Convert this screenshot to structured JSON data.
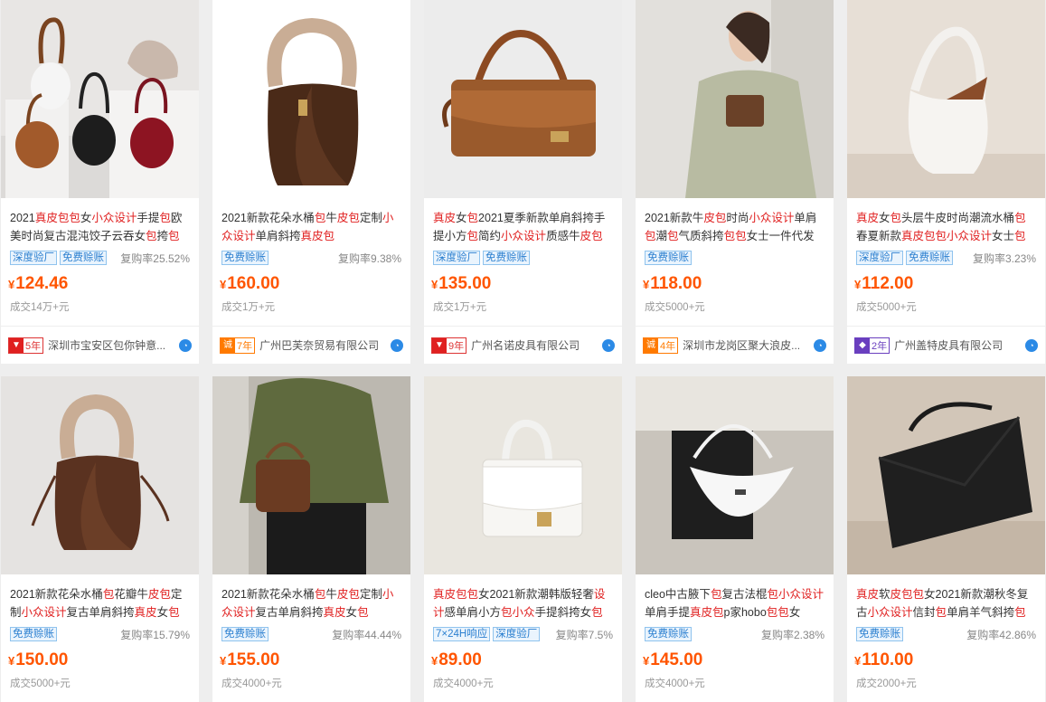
{
  "products": [
    {
      "title_parts": [
        [
          "2021",
          0
        ],
        [
          "真皮包包",
          1
        ],
        [
          "女",
          0
        ],
        [
          "小众设计",
          1
        ],
        [
          "手提",
          0
        ],
        [
          "包",
          1
        ],
        [
          "欧美时尚复古混沌饺子云吞女",
          0
        ],
        [
          "包",
          1
        ],
        [
          "挎",
          0
        ],
        [
          "包",
          1
        ]
      ],
      "tags": [
        "深度验厂",
        "免费赊账"
      ],
      "rate": "复购率25.52%",
      "price": "124.46",
      "deal": "成交14万+元",
      "years": "5年",
      "year_style": "red",
      "shop": "深圳市宝安区包你钟意..."
    },
    {
      "title_parts": [
        [
          "2021新款花朵水桶",
          0
        ],
        [
          "包",
          1
        ],
        [
          "牛",
          0
        ],
        [
          "皮包",
          1
        ],
        [
          "定制",
          0
        ],
        [
          "小众设计",
          1
        ],
        [
          "单肩斜挎",
          0
        ],
        [
          "真皮包",
          1
        ]
      ],
      "tags": [
        "免费赊账"
      ],
      "rate": "复购率9.38%",
      "price": "160.00",
      "deal": "成交1万+元",
      "years": "7年",
      "year_style": "orange",
      "shop": "广州巴芙奈贸易有限公司"
    },
    {
      "title_parts": [
        [
          "真皮",
          1
        ],
        [
          "女",
          0
        ],
        [
          "包",
          1
        ],
        [
          "2021夏季新款单肩斜挎手提小方",
          0
        ],
        [
          "包",
          1
        ],
        [
          "简约",
          0
        ],
        [
          "小众设计",
          1
        ],
        [
          "质感牛",
          0
        ],
        [
          "皮包",
          1
        ]
      ],
      "tags": [
        "深度验厂",
        "免费赊账"
      ],
      "rate": "",
      "price": "135.00",
      "deal": "成交1万+元",
      "years": "9年",
      "year_style": "red",
      "shop": "广州名诺皮具有限公司"
    },
    {
      "title_parts": [
        [
          "2021新款牛",
          0
        ],
        [
          "皮包",
          1
        ],
        [
          "时尚",
          0
        ],
        [
          "小众设计",
          1
        ],
        [
          "单肩",
          0
        ],
        [
          "包",
          1
        ],
        [
          "潮",
          0
        ],
        [
          "包",
          1
        ],
        [
          "气质斜挎",
          0
        ],
        [
          "包包",
          1
        ],
        [
          "女士一件代发",
          0
        ]
      ],
      "tags": [
        "免费赊账"
      ],
      "rate": "",
      "price": "118.00",
      "deal": "成交5000+元",
      "years": "4年",
      "year_style": "orange",
      "shop": "深圳市龙岗区聚大浪皮..."
    },
    {
      "title_parts": [
        [
          "真皮",
          1
        ],
        [
          "女",
          0
        ],
        [
          "包",
          1
        ],
        [
          "头层牛皮时尚潮流水桶",
          0
        ],
        [
          "包",
          1
        ],
        [
          "春夏新款",
          0
        ],
        [
          "真皮包包小众设计",
          1
        ],
        [
          "女士",
          0
        ],
        [
          "包",
          1
        ]
      ],
      "tags": [
        "深度验厂",
        "免费赊账"
      ],
      "rate": "复购率3.23%",
      "price": "112.00",
      "deal": "成交5000+元",
      "years": "2年",
      "year_style": "purple",
      "shop": "广州盖特皮具有限公司"
    },
    {
      "title_parts": [
        [
          "2021新款花朵水桶",
          0
        ],
        [
          "包",
          1
        ],
        [
          "花瓣牛",
          0
        ],
        [
          "皮包",
          1
        ],
        [
          "定制",
          0
        ],
        [
          "小众设计",
          1
        ],
        [
          "复古单肩斜挎",
          0
        ],
        [
          "真皮",
          1
        ],
        [
          "女",
          0
        ],
        [
          "包",
          1
        ]
      ],
      "tags": [
        "免费赊账"
      ],
      "rate": "复购率15.79%",
      "price": "150.00",
      "deal": "成交5000+元"
    },
    {
      "title_parts": [
        [
          "2021新款花朵水桶",
          0
        ],
        [
          "包",
          1
        ],
        [
          "牛",
          0
        ],
        [
          "皮包",
          1
        ],
        [
          "定制",
          0
        ],
        [
          "小众设计",
          1
        ],
        [
          "复古单肩斜挎",
          0
        ],
        [
          "真皮",
          1
        ],
        [
          "女",
          0
        ],
        [
          "包",
          1
        ]
      ],
      "tags": [
        "免费赊账"
      ],
      "rate": "复购率44.44%",
      "price": "155.00",
      "deal": "成交4000+元"
    },
    {
      "title_parts": [
        [
          "真皮包包",
          1
        ],
        [
          "女2021新款潮韩版轻奢",
          0
        ],
        [
          "设计",
          1
        ],
        [
          "感单肩小方",
          0
        ],
        [
          "包",
          1
        ],
        [
          "小众",
          1
        ],
        [
          "手提斜挎女",
          0
        ],
        [
          "包",
          1
        ]
      ],
      "tags": [
        "7×24H响应",
        "深度验厂"
      ],
      "rate": "复购率7.5%",
      "price": "89.00",
      "deal": "成交4000+元"
    },
    {
      "title_parts": [
        [
          "cleo中古腋下",
          0
        ],
        [
          "包",
          1
        ],
        [
          "复古法棍",
          0
        ],
        [
          "包",
          1
        ],
        [
          "小众设计",
          1
        ],
        [
          "单肩手提",
          0
        ],
        [
          "真皮包",
          1
        ],
        [
          "p家hobo",
          0
        ],
        [
          "包包",
          1
        ],
        [
          "女",
          0
        ]
      ],
      "tags": [
        "免费赊账"
      ],
      "rate": "复购率2.38%",
      "price": "145.00",
      "deal": "成交4000+元"
    },
    {
      "title_parts": [
        [
          "真皮",
          1
        ],
        [
          "软",
          0
        ],
        [
          "皮包包",
          1
        ],
        [
          "女2021新款潮秋冬复古",
          0
        ],
        [
          "小众设计",
          1
        ],
        [
          "信封",
          0
        ],
        [
          "包",
          1
        ],
        [
          "单肩羊气斜挎",
          0
        ],
        [
          "包",
          1
        ]
      ],
      "tags": [
        "免费赊账"
      ],
      "rate": "复购率42.86%",
      "price": "110.00",
      "deal": "成交2000+元"
    }
  ],
  "currency": "¥",
  "colors": {
    "highlight": "#e02020",
    "price": "#ff5500",
    "tag_blue": "#2b7fd0"
  }
}
